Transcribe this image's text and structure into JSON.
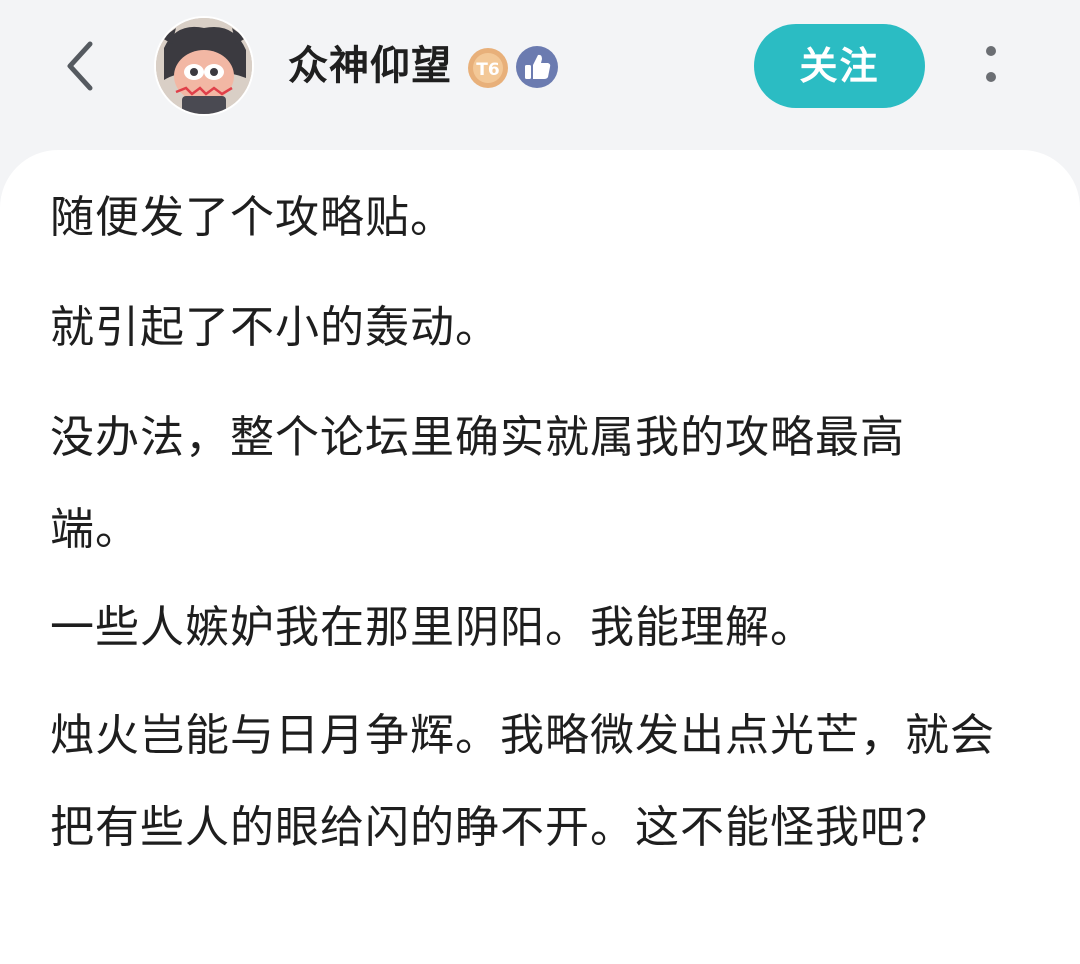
{
  "header": {
    "back_icon": "chevron-left-icon",
    "username": "众神仰望",
    "level_badge": "T6",
    "like_badge_icon": "thumbs-up-icon",
    "follow_label": "关注",
    "more_icon": "more-vertical-icon"
  },
  "colors": {
    "accent": "#2bbcc3",
    "like_badge": "#6b7bb0",
    "level_badge": "#e8b07a",
    "background": "#f3f4f6",
    "card": "#ffffff"
  },
  "post": {
    "paragraphs": [
      "随便发了个攻略贴。",
      "就引起了不小的轰动。",
      "没办法，整个论坛里确实就属我的攻略最高端。",
      "一些人嫉妒我在那里阴阳。我能理解。",
      "烛火岂能与日月争辉。我略微发出点光芒，就会把有些人的眼给闪的睁不开。这不能怪我吧？"
    ]
  }
}
